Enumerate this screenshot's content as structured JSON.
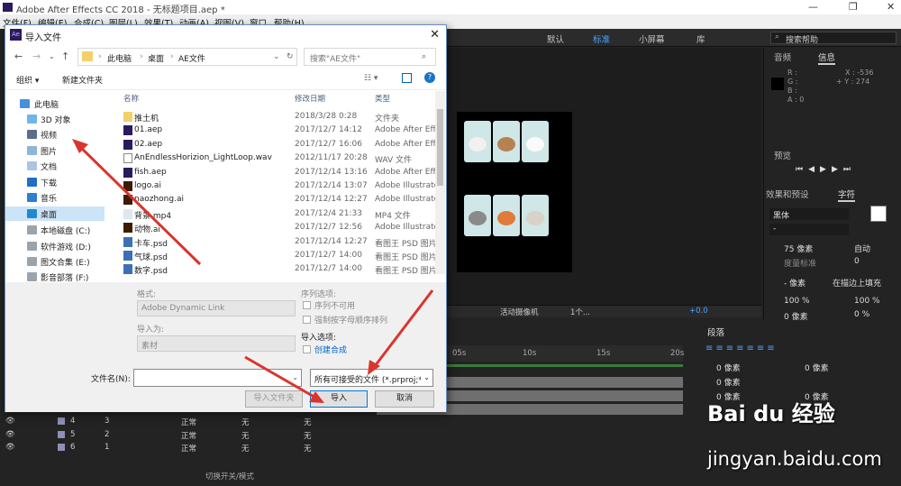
{
  "app": {
    "title": "Adobe After Effects CC 2018 - 无标题项目.aep *"
  },
  "menu": [
    "文件(F)",
    "编辑(E)",
    "合成(C)",
    "图层(L)",
    "效果(T)",
    "动画(A)",
    "视图(V)",
    "窗口",
    "帮助(H)"
  ],
  "workspace": {
    "tabs": [
      "默认",
      "标准",
      "小屏幕",
      "库"
    ],
    "active": "标准",
    "search_label": "搜索帮助"
  },
  "info_panel": {
    "tabs": [
      "音频",
      "信息"
    ],
    "rgba": [
      "R :",
      "G :",
      "B :",
      "A : 0"
    ],
    "x": "X : -536",
    "y": "+ Y : 274"
  },
  "preview_panel": {
    "title": "预览"
  },
  "effects_panel": {
    "tabs": [
      "效果和预设",
      "字符"
    ]
  },
  "character": {
    "font": "黑体",
    "font_style": "-",
    "size": "75 像素",
    "leading": "自动",
    "kerning": "度量标准",
    "tracking": "0",
    "stroke": "- 像素",
    "stroke_mode": "在描边上填充",
    "vscale": "100 %",
    "hscale": "100 %",
    "baseline": "0 像素",
    "tsume": "0 %"
  },
  "comp_bar": {
    "camera": "活动摄像机",
    "view": "1个...",
    "offset": "+0.0"
  },
  "paragraph": {
    "title": "段落",
    "indent_values": [
      "0 像素",
      "0 像素",
      "0 像素",
      "0 像素",
      "0 像素"
    ]
  },
  "timeline": {
    "ruler": [
      "05s",
      "10s",
      "15s",
      "20s"
    ],
    "layers": [
      {
        "num": "4",
        "idx": "3",
        "mode": "正常",
        "trk": "无",
        "parent": "无"
      },
      {
        "num": "5",
        "idx": "2",
        "mode": "正常",
        "trk": "无",
        "parent": "无"
      },
      {
        "num": "6",
        "idx": "1",
        "mode": "正常",
        "trk": "无",
        "parent": "无"
      }
    ],
    "footer": "切换开关/模式"
  },
  "dialog": {
    "title": "导入文件",
    "breadcrumb": [
      "此电脑",
      "桌面",
      "AE文件"
    ],
    "search_placeholder": "搜索\"AE文件\"",
    "toolbar": {
      "organize": "组织 ▾",
      "new_folder": "新建文件夹"
    },
    "sidebar": [
      "此电脑",
      "3D 对象",
      "视频",
      "图片",
      "文档",
      "下载",
      "音乐",
      "桌面",
      "本地磁盘 (C:)",
      "软件游戏 (D:)",
      "图文合集 (E:)",
      "影音部落 (F:)"
    ],
    "sidebar_selected": "桌面",
    "columns": [
      "名称",
      "修改日期",
      "类型"
    ],
    "files": [
      {
        "name": "推土机",
        "date": "2018/3/28 0:28",
        "type": "文件夹",
        "kind": "folder"
      },
      {
        "name": "01.aep",
        "date": "2017/12/7 14:12",
        "type": "Adobe After Effe",
        "kind": "aep"
      },
      {
        "name": "02.aep",
        "date": "2017/12/7 16:06",
        "type": "Adobe After Effe",
        "kind": "aep"
      },
      {
        "name": "AnEndlessHorizion_LightLoop.wav",
        "date": "2012/11/17 20:28",
        "type": "WAV 文件",
        "kind": "wav"
      },
      {
        "name": "fish.aep",
        "date": "2017/12/14 13:16",
        "type": "Adobe After Effe",
        "kind": "aep"
      },
      {
        "name": "logo.ai",
        "date": "2017/12/14 13:07",
        "type": "Adobe Illustrato",
        "kind": "ai"
      },
      {
        "name": "naozhong.ai",
        "date": "2017/12/14 12:27",
        "type": "Adobe Illustrato",
        "kind": "ai"
      },
      {
        "name": "背景.mp4",
        "date": "2017/12/4 21:33",
        "type": "MP4 文件",
        "kind": "mp4"
      },
      {
        "name": "动物.ai",
        "date": "2017/12/7 12:56",
        "type": "Adobe Illustrato",
        "kind": "ai"
      },
      {
        "name": "卡车.psd",
        "date": "2017/12/14 12:27",
        "type": "看图王 PSD 图片",
        "kind": "psd"
      },
      {
        "name": "气球.psd",
        "date": "2017/12/7 14:00",
        "type": "看图王 PSD 图片",
        "kind": "psd"
      },
      {
        "name": "数字.psd",
        "date": "2017/12/7 14:00",
        "type": "看图王 PSD 图片",
        "kind": "psd"
      }
    ],
    "options": {
      "format_label": "格式:",
      "format_value": "Adobe Dynamic Link",
      "import_as_label": "导入为:",
      "import_as_value": "素材",
      "seq_label": "序列选项:",
      "seq_unavailable": "序列不可用",
      "force_alpha": "强制按字母顺序排列",
      "import_opts_label": "导入选项:",
      "create_comp": "创建合成"
    },
    "filename_label": "文件名(N):",
    "filetype": "所有可接受的文件 (*.prproj;*.c",
    "buttons": {
      "import_folder": "导入文件夹",
      "import": "导入",
      "cancel": "取消"
    }
  },
  "colors": {
    "accent": "#4aa3ff",
    "arrow": "#d9352e",
    "dialog_border": "#6b8fbf"
  },
  "watermark": {
    "brand": "Bai du 经验",
    "url": "jingyan.baidu.com"
  }
}
